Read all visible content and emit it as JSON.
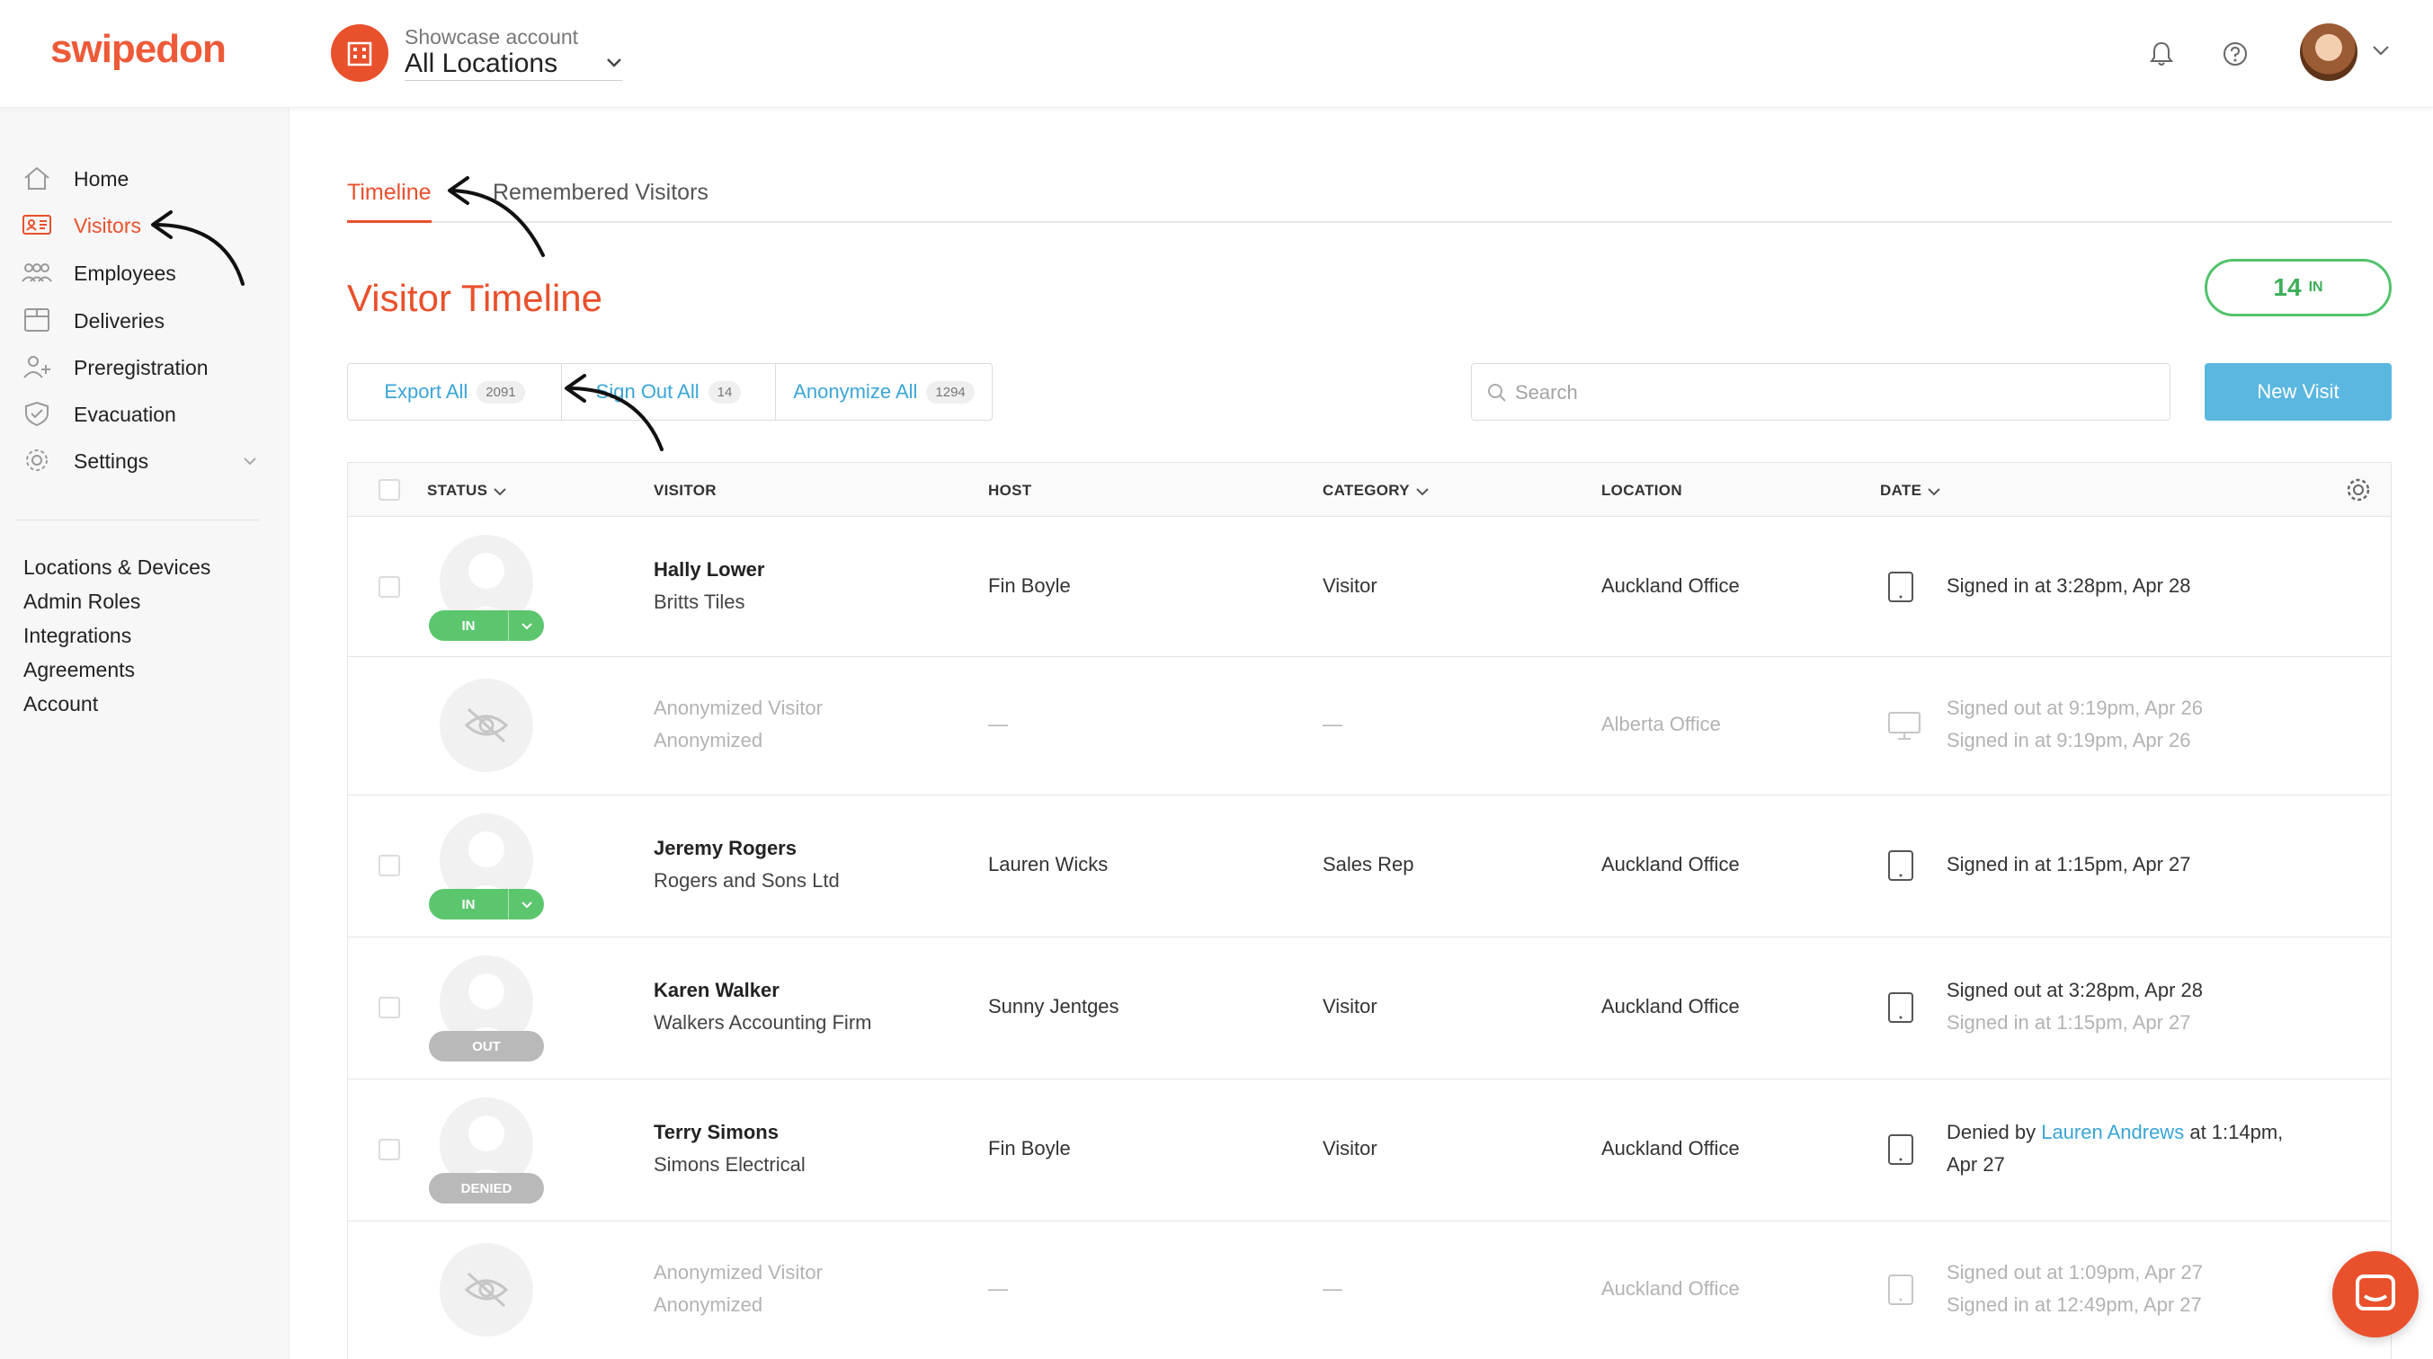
{
  "brand": {
    "logo": "swipedon",
    "accent": "#e9502c",
    "success": "#5cc66e",
    "link": "#3aa5d8"
  },
  "header": {
    "account_label": "Showcase account",
    "location_select": "All Locations",
    "icons": [
      "bell-icon",
      "help-icon",
      "avatar",
      "chevron-down-icon"
    ]
  },
  "sidebar": {
    "items": [
      {
        "label": "Home",
        "icon": "home-icon"
      },
      {
        "label": "Visitors",
        "icon": "visitors-icon",
        "active": true
      },
      {
        "label": "Employees",
        "icon": "employees-icon"
      },
      {
        "label": "Deliveries",
        "icon": "deliveries-icon"
      },
      {
        "label": "Preregistration",
        "icon": "preregistration-icon"
      },
      {
        "label": "Evacuation",
        "icon": "evacuation-icon"
      },
      {
        "label": "Settings",
        "icon": "settings-icon"
      }
    ],
    "links": [
      "Locations & Devices",
      "Admin Roles",
      "Integrations",
      "Agreements",
      "Account"
    ]
  },
  "main": {
    "tabs": [
      {
        "label": "Timeline",
        "active": true
      },
      {
        "label": "Remembered Visitors"
      }
    ],
    "title": "Visitor Timeline",
    "in_count": {
      "value": "14",
      "label": "IN"
    },
    "actions": [
      {
        "label": "Export All",
        "count": "2091"
      },
      {
        "label": "Sign Out All",
        "count": "14"
      },
      {
        "label": "Anonymize All",
        "count": "1294"
      }
    ],
    "search": {
      "placeholder": "Search",
      "value": ""
    },
    "new_visit": "New Visit"
  },
  "table": {
    "columns": [
      "STATUS",
      "VISITOR",
      "HOST",
      "CATEGORY",
      "LOCATION",
      "DATE"
    ],
    "rows": [
      {
        "status": "IN",
        "name": "Hally Lower",
        "company": "Britts Tiles",
        "host": "Fin Boyle",
        "category": "Visitor",
        "location": "Auckland Office",
        "device": "tablet-icon",
        "date1": "Signed in at 3:28pm, Apr 28",
        "date2": ""
      },
      {
        "status": "",
        "name": "Anonymized Visitor",
        "company": "Anonymized",
        "host": "—",
        "category": "—",
        "location": "Alberta Office",
        "device": "monitor-icon",
        "date1": "Signed out at 9:19pm, Apr 26",
        "date2": "Signed in at 9:19pm, Apr 26"
      },
      {
        "status": "IN",
        "name": "Jeremy Rogers",
        "company": "Rogers and Sons Ltd",
        "host": "Lauren Wicks",
        "category": "Sales Rep",
        "location": "Auckland Office",
        "device": "tablet-icon",
        "date1": "Signed in at 1:15pm, Apr 27",
        "date2": ""
      },
      {
        "status": "OUT",
        "name": "Karen Walker",
        "company": "Walkers Accounting Firm",
        "host": "Sunny Jentges",
        "category": "Visitor",
        "location": "Auckland Office",
        "device": "tablet-icon",
        "date1": "Signed out at 3:28pm, Apr 28",
        "date2": "Signed in at 1:15pm, Apr 27"
      },
      {
        "status": "DENIED",
        "name": "Terry Simons",
        "company": "Simons Electrical",
        "host": "Fin Boyle",
        "category": "Visitor",
        "location": "Auckland Office",
        "device": "tablet-icon",
        "date_prefix": "Denied by",
        "date_link": "Lauren Andrews",
        "date_suffix": "at 1:14pm,",
        "date2": "Apr 27"
      },
      {
        "status": "",
        "name": "Anonymized Visitor",
        "company": "Anonymized",
        "host": "—",
        "category": "—",
        "location": "Auckland Office",
        "device": "tablet-icon",
        "date1": "Signed out at 1:09pm, Apr 27",
        "date2": "Signed in at 12:49pm, Apr 27"
      }
    ]
  }
}
